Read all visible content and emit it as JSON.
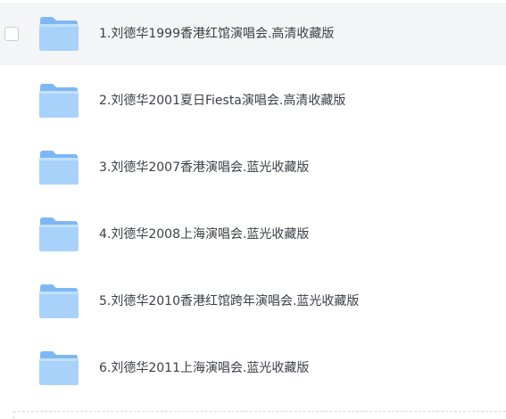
{
  "files": [
    {
      "name": "1.刘德华1999香港红馆演唱会.高清收藏版",
      "icon": "folder-icon",
      "hovered": true
    },
    {
      "name": "2.刘德华2001夏日Fiesta演唱会.高清收藏版",
      "icon": "folder-icon",
      "hovered": false
    },
    {
      "name": "3.刘德华2007香港演唱会.蓝光收藏版",
      "icon": "folder-icon",
      "hovered": false
    },
    {
      "name": "4.刘德华2008上海演唱会.蓝光收藏版",
      "icon": "folder-icon",
      "hovered": false
    },
    {
      "name": "5.刘德华2010香港红馆跨年演唱会.蓝光收藏版",
      "icon": "folder-icon",
      "hovered": false
    },
    {
      "name": "6.刘德华2011上海演唱会.蓝光收藏版",
      "icon": "folder-icon",
      "hovered": false
    }
  ],
  "colors": {
    "folder_front": "#a9d2fb",
    "folder_back": "#7db8f5",
    "text": "#3c3f45",
    "hover_bg": "#f4f5f6"
  }
}
